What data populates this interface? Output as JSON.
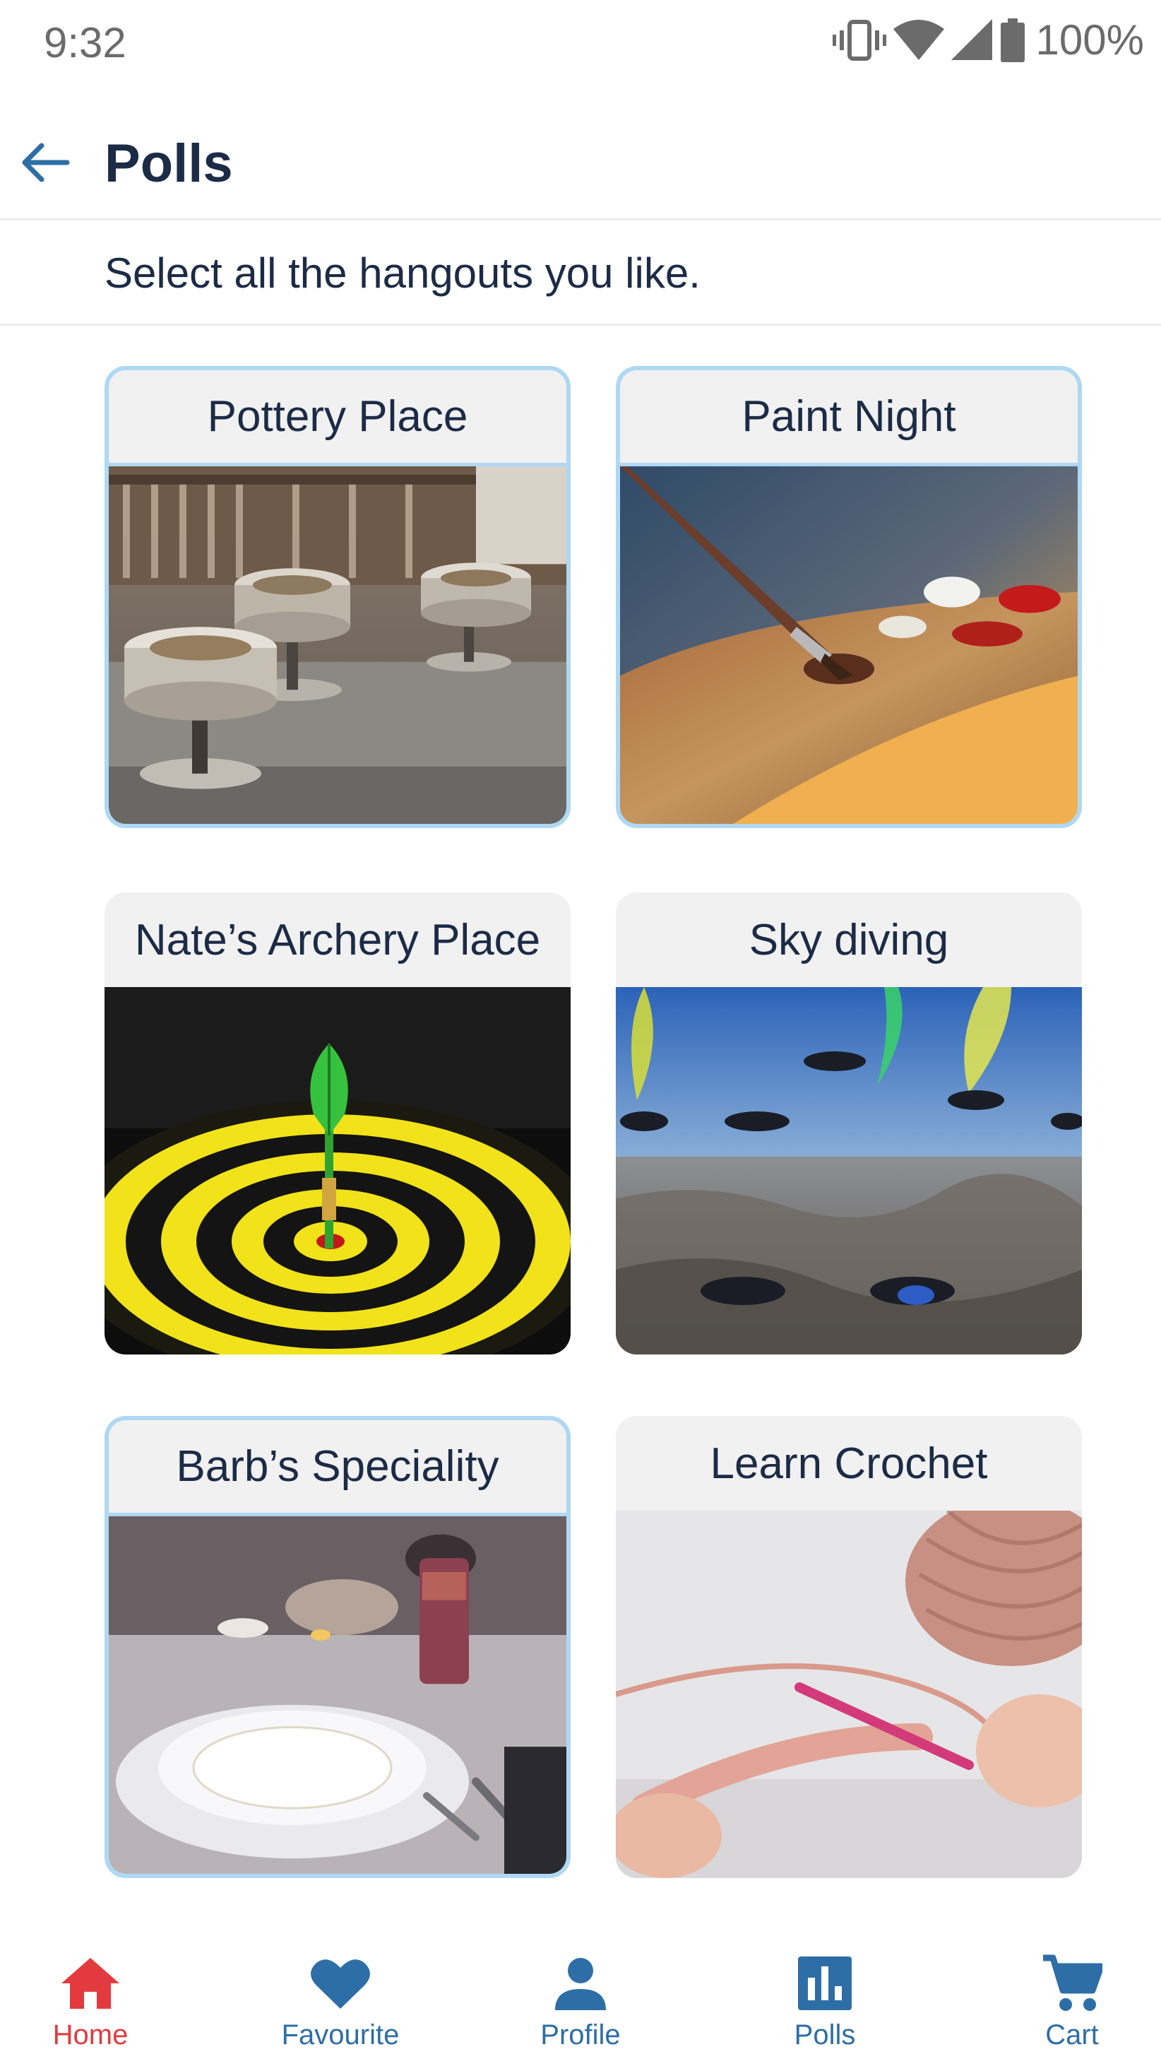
{
  "status_bar": {
    "time": "9:32",
    "battery": "100%",
    "icons": [
      "vibrate-icon",
      "wifi-icon",
      "signal-icon",
      "battery-icon"
    ]
  },
  "header": {
    "back_icon": "arrow-left-icon",
    "title": "Polls"
  },
  "subtitle": "Select all the hangouts you like.",
  "polls": [
    {
      "label": "Pottery Place",
      "selected": true,
      "image": "pottery wheels photo"
    },
    {
      "label": "Paint Night",
      "selected": true,
      "image": "paint brush and palette photo"
    },
    {
      "label": "Nate’s Archery Place",
      "selected": false,
      "image": "dart in yellow target photo"
    },
    {
      "label": "Sky diving",
      "selected": false,
      "image": "skydivers in sky photo"
    },
    {
      "label": "Barb’s Speciality",
      "selected": true,
      "image": "table setting photo"
    },
    {
      "label": "Learn Crochet",
      "selected": false,
      "image": "crochet yarn photo"
    }
  ],
  "bottom_nav": {
    "items": [
      {
        "label": "Home",
        "icon": "home-icon",
        "active": true
      },
      {
        "label": "Favourite",
        "icon": "heart-icon",
        "active": false
      },
      {
        "label": "Profile",
        "icon": "person-icon",
        "active": false
      },
      {
        "label": "Polls",
        "icon": "poll-icon",
        "active": false
      },
      {
        "label": "Cart",
        "icon": "cart-icon",
        "active": false
      }
    ]
  },
  "colors": {
    "accent_blue": "#2e6ea6",
    "active_red": "#e23a3f",
    "selected_border": "#aed8f3",
    "title_text": "#1c2b46"
  }
}
